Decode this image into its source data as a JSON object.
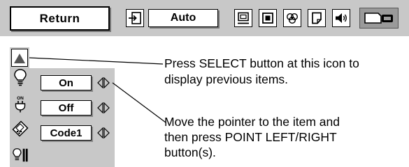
{
  "menubar": {
    "return_label": "Return",
    "mode_value": "Auto",
    "icons": [
      "input-source-icon",
      "screen-icon",
      "square-icon",
      "color-icon",
      "page-icon",
      "speaker-icon",
      "projector-icon"
    ]
  },
  "panel": {
    "rows": [
      {
        "icon": "lamp-icon",
        "value": "On"
      },
      {
        "icon": "power-on-icon",
        "value": "Off"
      },
      {
        "icon": "remote-code-icon",
        "value": "Code1"
      },
      {
        "icon": "lamp-tools-icon"
      }
    ]
  },
  "callouts": {
    "select_line1": "Press SELECT button at this icon to",
    "select_line2": "display previous items.",
    "move_line1": "Move the pointer to the item and",
    "move_line2": "then press POINT LEFT/RIGHT",
    "move_line3": "button(s)."
  },
  "colors": {
    "bar_background": "#c8c8c8",
    "selected_background": "#9a9a9a"
  }
}
